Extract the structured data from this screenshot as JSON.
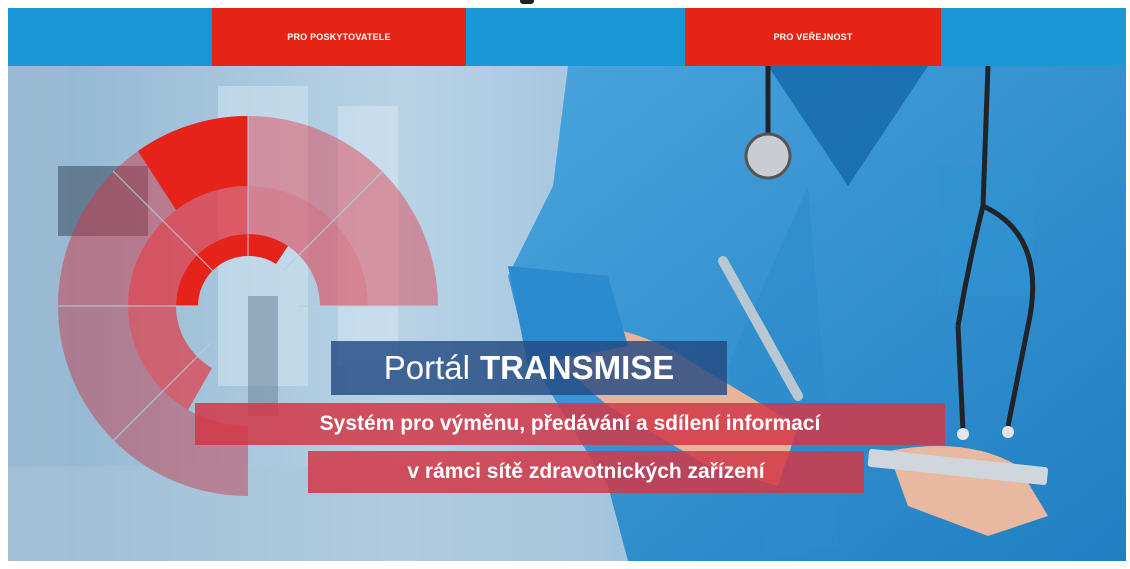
{
  "nav": {
    "providers_label": "PRO POSKYTOVATELE",
    "public_label": "PRO VEŘEJNOST"
  },
  "hero": {
    "title_prefix": "Portál",
    "title_strong": "TRANSMISE",
    "subtitle_line1": "Systém pro výměnu, předávání a sdílení informací",
    "subtitle_line2": "v rámci sítě zdravotnických zařízení"
  },
  "colors": {
    "top_bar": "#1a98d5",
    "nav_button": "#e52416",
    "title_box": "#234b82",
    "subtitle_box": "#d23746"
  }
}
